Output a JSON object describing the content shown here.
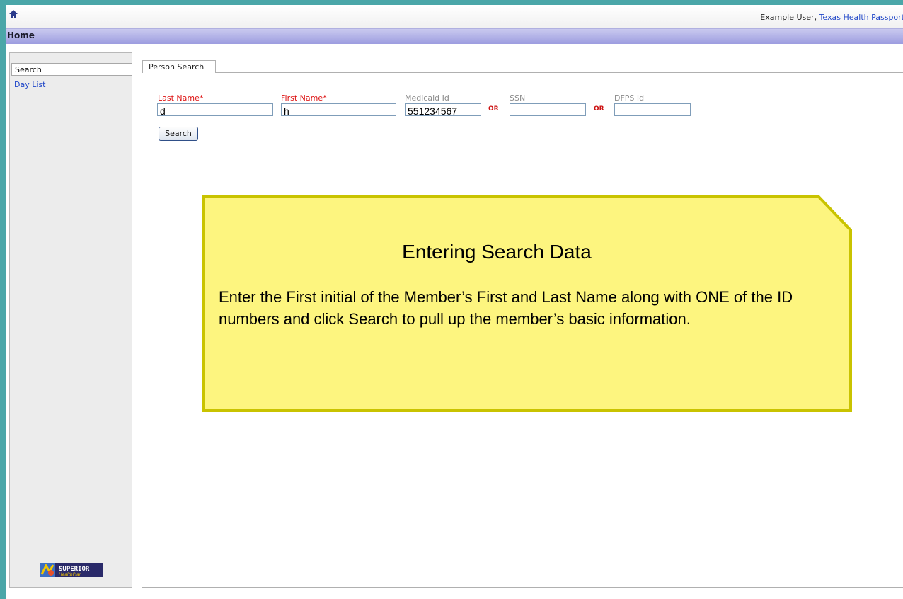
{
  "topbar": {
    "user_name": "Example User",
    "separator": ", ",
    "org_link": "Texas Health Passport"
  },
  "homebar": {
    "title": "Home"
  },
  "sidebar": {
    "items": [
      {
        "label": "Search",
        "selected": true
      },
      {
        "label": "Day List",
        "selected": false
      }
    ],
    "logo": {
      "text": "SUPERIOR",
      "subtext": "HealthPlan"
    }
  },
  "main": {
    "tab_label": "Person Search",
    "fields": [
      {
        "label": "Last Name",
        "required": true,
        "value": "d"
      },
      {
        "label": "First Name",
        "required": true,
        "value": "h"
      },
      {
        "label": "Medicaid Id",
        "required": false,
        "value": "551234567"
      },
      {
        "label": "SSN",
        "required": false,
        "value": ""
      },
      {
        "label": "DFPS Id",
        "required": false,
        "value": ""
      }
    ],
    "or_label": "OR",
    "search_button": "Search"
  },
  "callout": {
    "title": "Entering Search Data",
    "body": "Enter the First initial of the Member’s First and Last Name along with ONE of the ID numbers and click Search to pull up the member’s basic information."
  },
  "colors": {
    "required_label": "#dd1111",
    "link": "#1f46c8",
    "callout_fill": "#fdf57f",
    "callout_border": "#c9c300",
    "homebar": "#b3b3e8"
  }
}
